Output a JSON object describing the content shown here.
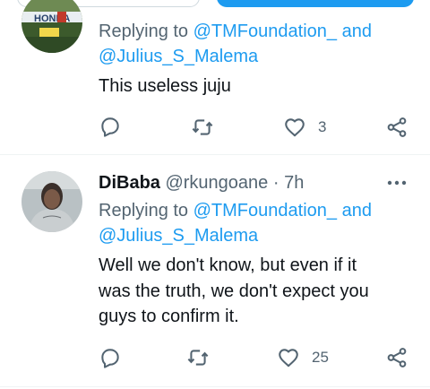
{
  "tweet1": {
    "replying_prefix": "Replying to",
    "mention1": "@TMFoundation_",
    "and_word": "and",
    "mention2": "@Julius_S_Malema",
    "text": "This useless juju",
    "avatar_text": "HONDA",
    "like_count": "3"
  },
  "tweet2": {
    "display_name": "DiBaba",
    "handle": "@rkungoane",
    "separator": "·",
    "time": "7h",
    "replying_prefix": "Replying to",
    "mention1": "@TMFoundation_",
    "and_word": "and",
    "mention2": "@Julius_S_Malema",
    "text_lines": [
      "Well we don't know,  but even if it",
      "was the truth, we don't expect you",
      "guys to confirm it."
    ],
    "like_count": "25"
  },
  "icons": {
    "reply": "reply-bubble-icon",
    "retweet": "retweet-icon",
    "like": "heart-icon",
    "share": "share-icon",
    "more": "more-dots-icon"
  },
  "colors": {
    "link_blue": "#1d9bf0",
    "secondary_text": "#536471",
    "primary_text": "#0f1419",
    "divider": "#eff3f4"
  }
}
